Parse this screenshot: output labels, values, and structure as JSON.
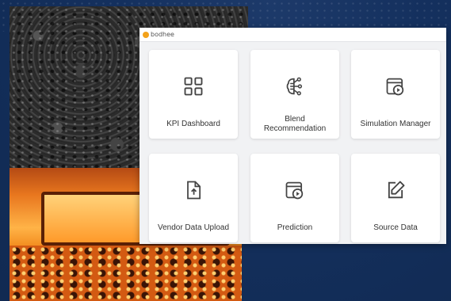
{
  "brand": {
    "name": "bodhee",
    "accent": "#f3a21b"
  },
  "background": {
    "color": "#14305e"
  },
  "cards": [
    {
      "label": "KPI Dashboard",
      "icon": "grid-icon"
    },
    {
      "label": "Blend Recommendation",
      "icon": "brain-circuit-icon"
    },
    {
      "label": "Simulation Manager",
      "icon": "play-window-icon"
    },
    {
      "label": "Vendor Data Upload",
      "icon": "upload-file-icon"
    },
    {
      "label": "Prediction",
      "icon": "play-window-icon"
    },
    {
      "label": "Source Data",
      "icon": "edit-icon"
    }
  ]
}
